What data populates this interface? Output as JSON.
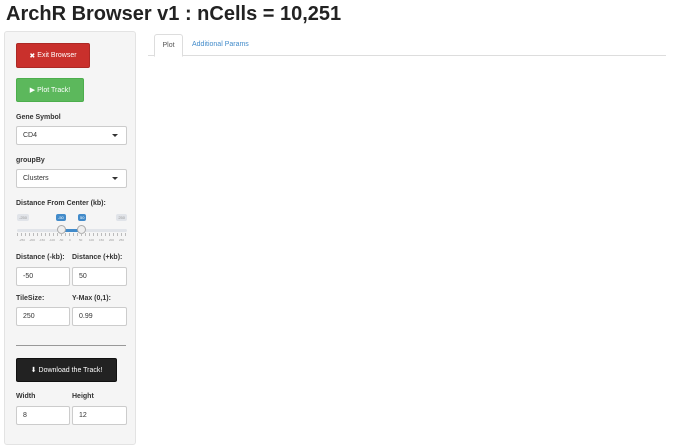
{
  "header": {
    "title": "ArchR Browser v1 : nCells = 10,251"
  },
  "sidebar": {
    "exit_button": "Exit Browser",
    "plot_button": "Plot Track!",
    "gene_symbol": {
      "label": "Gene Symbol",
      "value": "CD4"
    },
    "group_by": {
      "label": "groupBy",
      "value": "Clusters"
    },
    "distance_slider": {
      "label": "Distance From Center (kb):",
      "min": -250,
      "max": 250,
      "from": -50,
      "to": 50,
      "min_label": "-250",
      "max_label": "250",
      "from_label": "-50",
      "to_label": "50",
      "grid_labels": [
        "-250",
        "-200",
        "-150",
        "-100",
        "-50",
        "0",
        "50",
        "100",
        "150",
        "200",
        "250"
      ]
    },
    "distance_minus": {
      "label": "Distance (-kb):",
      "value": "-50"
    },
    "distance_plus": {
      "label": "Distance (+kb):",
      "value": "50"
    },
    "tile_size": {
      "label": "TileSize:",
      "value": "250"
    },
    "y_max": {
      "label": "Y-Max (0,1):",
      "value": "0.99"
    },
    "download_button": "Download the Track!",
    "width": {
      "label": "Width",
      "value": "8"
    },
    "height": {
      "label": "Height",
      "value": "12"
    }
  },
  "tabs": [
    {
      "label": "Plot",
      "active": true
    },
    {
      "label": "Additional Params",
      "active": false
    }
  ],
  "colors": {
    "exit": "#c9302c",
    "plot": "#5cb85c",
    "download": "#222222",
    "link": "#428bca"
  }
}
